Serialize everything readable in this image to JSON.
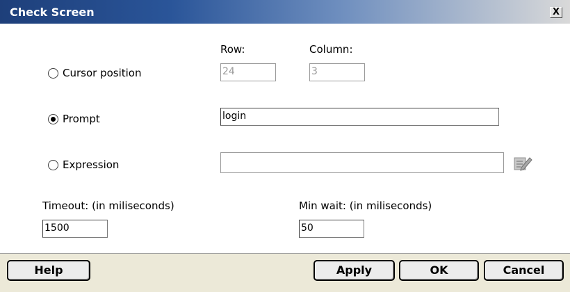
{
  "window": {
    "title": "Check Screen",
    "close_label": "X"
  },
  "cursor": {
    "option_label": "Cursor position",
    "row_label": "Row:",
    "row_value": "24",
    "column_label": "Column:",
    "column_value": "3"
  },
  "prompt": {
    "option_label": "Prompt",
    "value": "login",
    "selected": true
  },
  "expression": {
    "option_label": "Expression",
    "value": "",
    "edit_icon": "edit-expression-icon"
  },
  "timeout": {
    "label": "Timeout: (in miliseconds)",
    "value": "1500"
  },
  "minwait": {
    "label": "Min wait: (in miliseconds)",
    "value": "50"
  },
  "buttons": {
    "help": "Help",
    "apply": "Apply",
    "ok": "OK",
    "cancel": "Cancel"
  }
}
